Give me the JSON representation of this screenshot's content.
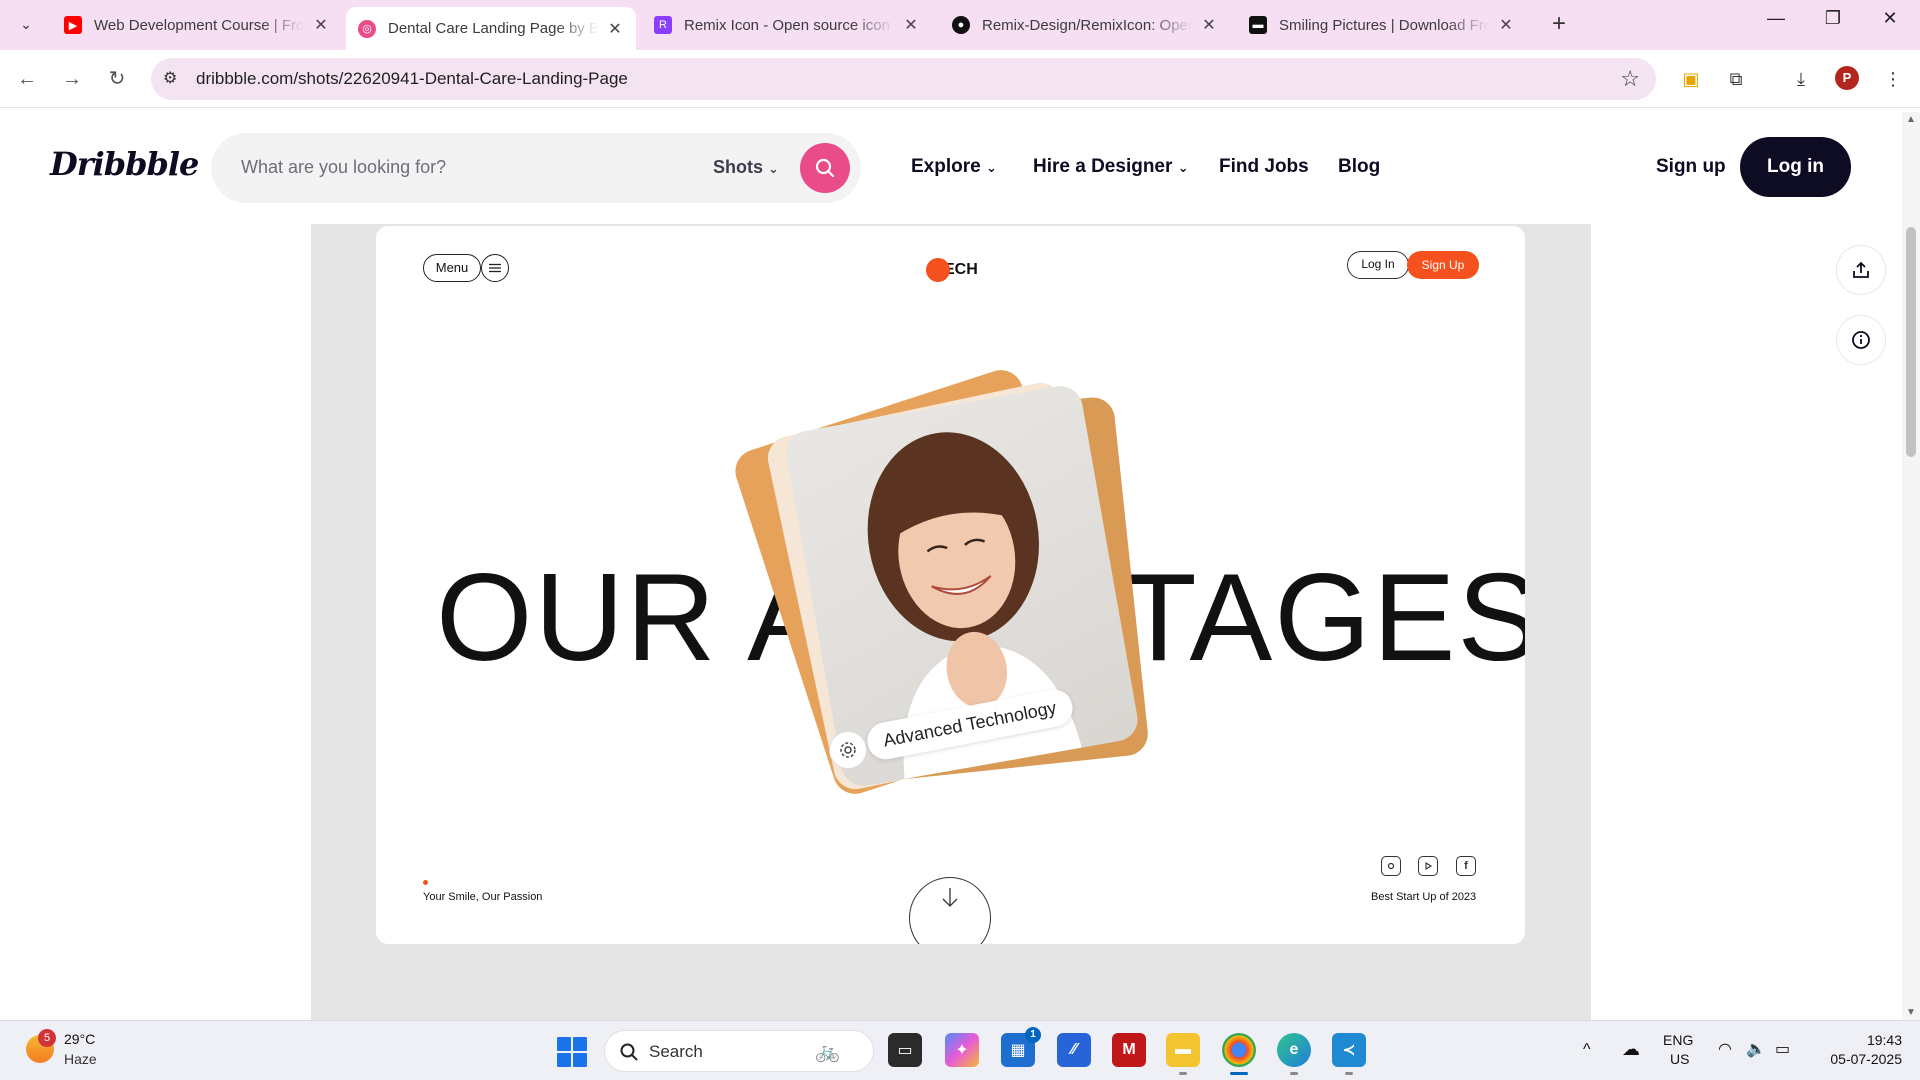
{
  "browser": {
    "tabs": [
      {
        "title": "Web Development Course | Fro",
        "favicon": "youtube-icon",
        "color": "#ff0000"
      },
      {
        "title": "Dental Care Landing Page by Bo",
        "favicon": "dribbble-icon",
        "color": "#ea4c89",
        "active": true
      },
      {
        "title": "Remix Icon - Open source icon",
        "favicon": "remixicon-icon",
        "color": "#8a3ffc"
      },
      {
        "title": "Remix-Design/RemixIcon: Open",
        "favicon": "github-icon",
        "color": "#111111"
      },
      {
        "title": "Smiling Pictures | Download Fre",
        "favicon": "unsplash-icon",
        "color": "#111111"
      }
    ],
    "url": "dribbble.com/shots/22620941-Dental-Care-Landing-Page",
    "profile_initial": "P"
  },
  "dribbble": {
    "search_placeholder": "What are you looking for?",
    "shots_label": "Shots",
    "nav": [
      "Explore",
      "Hire a Designer",
      "Find Jobs",
      "Blog"
    ],
    "signup": "Sign up",
    "login": "Log in",
    "brand_color": "#ea4c89"
  },
  "shot": {
    "menu_label": "Menu",
    "logo_text": "ECH",
    "login": "Log In",
    "signup": "Sign Up",
    "headline_left": "OUR A",
    "headline_right": "TAGES",
    "badge": "Advanced Technology",
    "tagline": "Your Smile, Our Passion",
    "best": "Best Start Up of 2023",
    "accent_color": "#f4511e"
  },
  "taskbar": {
    "weather_badge": "5",
    "temperature": "29°C",
    "weather": "Haze",
    "search_label": "Search",
    "teams_badge": "1",
    "lang_top": "ENG",
    "lang_bottom": "US",
    "time": "19:43",
    "date": "05-07-2025"
  }
}
